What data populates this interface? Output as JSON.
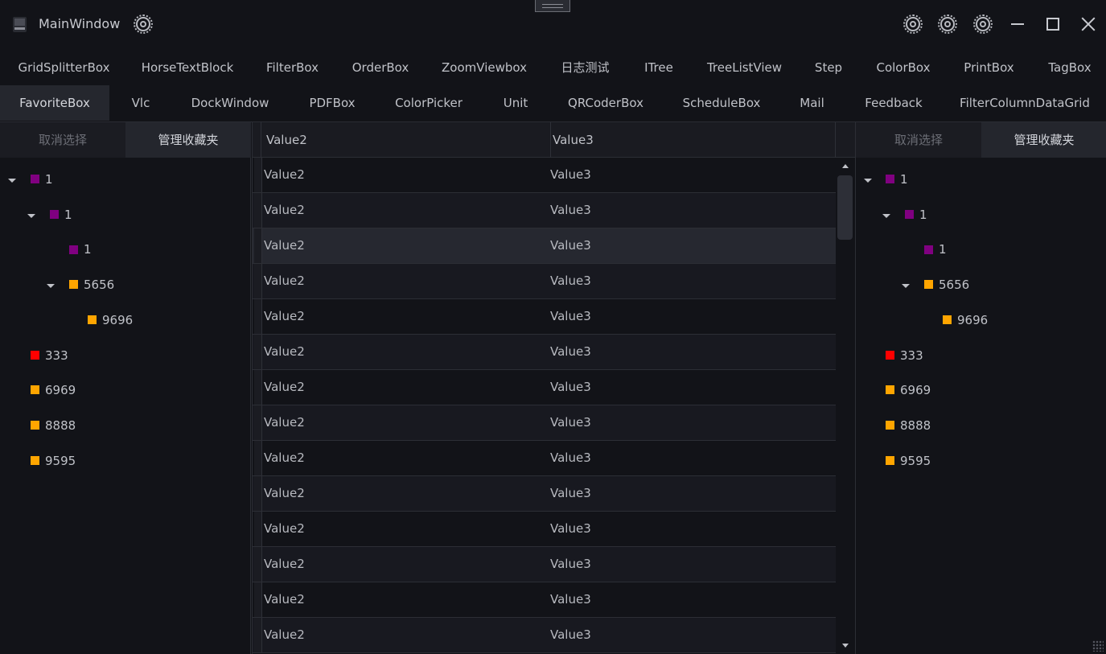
{
  "window": {
    "title": "MainWindow"
  },
  "tabs_row1": [
    "GridSplitterBox",
    "HorseTextBlock",
    "FilterBox",
    "OrderBox",
    "ZoomViewbox",
    "日志测试",
    "ITree",
    "TreeListView",
    "Step",
    "ColorBox",
    "PrintBox",
    "TagBox"
  ],
  "tabs_row2": [
    "FavoriteBox",
    "Vlc",
    "DockWindow",
    "PDFBox",
    "ColorPicker",
    "Unit",
    "QRCoderBox",
    "ScheduleBox",
    "Mail",
    "Feedback",
    "FilterColumnDataGrid"
  ],
  "active_tab": "FavoriteBox",
  "left_panel": {
    "segments": [
      "取消选择",
      "管理收藏夹"
    ],
    "selected_segment": "管理收藏夹",
    "tree": [
      {
        "label": "1",
        "color": "#800080",
        "level": 0,
        "expanded": true
      },
      {
        "label": "1",
        "color": "#800080",
        "level": 1,
        "expanded": true
      },
      {
        "label": "1",
        "color": "#800080",
        "level": 2,
        "expanded": null
      },
      {
        "label": "5656",
        "color": "#FFA500",
        "level": 2,
        "expanded": true
      },
      {
        "label": "9696",
        "color": "#FFA500",
        "level": 3,
        "expanded": null
      },
      {
        "label": "333",
        "color": "#FF0000",
        "level": 0,
        "expanded": null
      },
      {
        "label": "6969",
        "color": "#FFA500",
        "level": 0,
        "expanded": null
      },
      {
        "label": "8888",
        "color": "#FFA500",
        "level": 0,
        "expanded": null
      },
      {
        "label": "9595",
        "color": "#FFA500",
        "level": 0,
        "expanded": null
      }
    ]
  },
  "right_panel": {
    "segments": [
      "取消选择",
      "管理收藏夹"
    ],
    "selected_segment": "管理收藏夹",
    "tree": [
      {
        "label": "1",
        "color": "#800080",
        "level": 0,
        "expanded": true
      },
      {
        "label": "1",
        "color": "#800080",
        "level": 1,
        "expanded": true
      },
      {
        "label": "1",
        "color": "#800080",
        "level": 2,
        "expanded": null
      },
      {
        "label": "5656",
        "color": "#FFA500",
        "level": 2,
        "expanded": true
      },
      {
        "label": "9696",
        "color": "#FFA500",
        "level": 3,
        "expanded": null
      },
      {
        "label": "333",
        "color": "#FF0000",
        "level": 0,
        "expanded": null
      },
      {
        "label": "6969",
        "color": "#FFA500",
        "level": 0,
        "expanded": null
      },
      {
        "label": "8888",
        "color": "#FFA500",
        "level": 0,
        "expanded": null
      },
      {
        "label": "9595",
        "color": "#FFA500",
        "level": 0,
        "expanded": null
      }
    ]
  },
  "grid": {
    "columns": [
      "Value2",
      "Value3"
    ],
    "rows": [
      [
        "Value2",
        "Value3"
      ],
      [
        "Value2",
        "Value3"
      ],
      [
        "Value2",
        "Value3"
      ],
      [
        "Value2",
        "Value3"
      ],
      [
        "Value2",
        "Value3"
      ],
      [
        "Value2",
        "Value3"
      ],
      [
        "Value2",
        "Value3"
      ],
      [
        "Value2",
        "Value3"
      ],
      [
        "Value2",
        "Value3"
      ],
      [
        "Value2",
        "Value3"
      ],
      [
        "Value2",
        "Value3"
      ],
      [
        "Value2",
        "Value3"
      ],
      [
        "Value2",
        "Value3"
      ],
      [
        "Value2",
        "Value3"
      ]
    ],
    "selected_row": 2
  },
  "icons": {
    "app": "app-window-icon",
    "settings": "gear-icon",
    "minimize": "minimize-icon",
    "maximize": "maximize-icon",
    "close": "close-icon",
    "expand": "caret-down-icon"
  }
}
